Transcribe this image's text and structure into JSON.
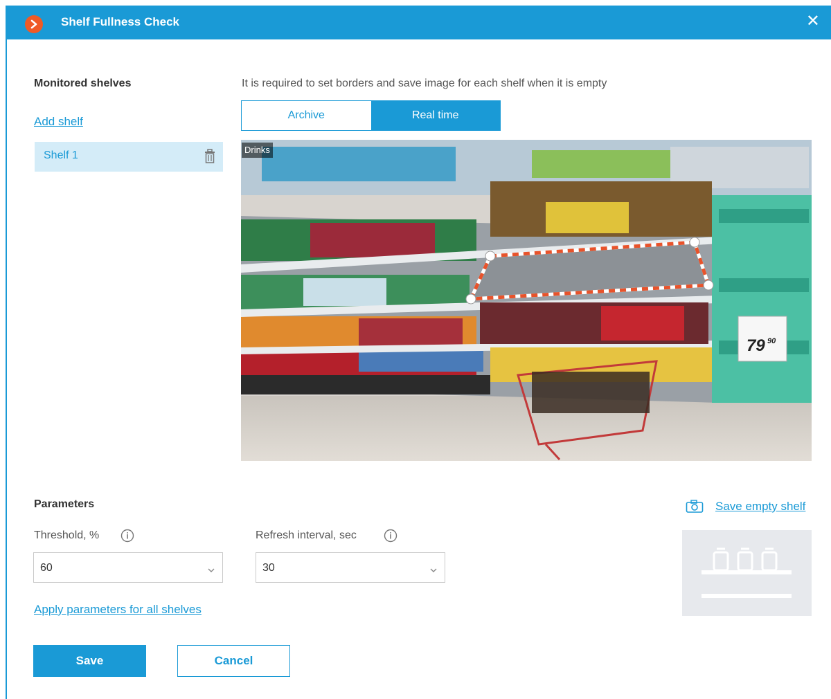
{
  "window": {
    "title": "Shelf Fullness Check",
    "close_icon": "close-icon",
    "logo_icon": "app-logo-icon"
  },
  "sidebar": {
    "title": "Monitored shelves",
    "add_link": "Add shelf",
    "items": [
      {
        "label": "Shelf 1",
        "icon": "trash-icon"
      }
    ]
  },
  "main": {
    "hint": "It is required to set borders and save image for each shelf when it is empty",
    "tabs": [
      {
        "label": "Archive",
        "active": false
      },
      {
        "label": "Real time",
        "active": true
      }
    ],
    "camera_name": "Drinks"
  },
  "parameters": {
    "title": "Parameters",
    "threshold": {
      "label": "Threshold, %",
      "value": "60"
    },
    "refresh": {
      "label": "Refresh interval, sec",
      "value": "30"
    },
    "apply_link": "Apply parameters for all shelves",
    "save_empty_link": "Save empty shelf"
  },
  "buttons": {
    "save": "Save",
    "cancel": "Cancel"
  },
  "colors": {
    "accent": "#1a9ad6",
    "logo": "#ef5a26",
    "selection": "#d4ecf8",
    "border_dash": "#e8532b"
  }
}
